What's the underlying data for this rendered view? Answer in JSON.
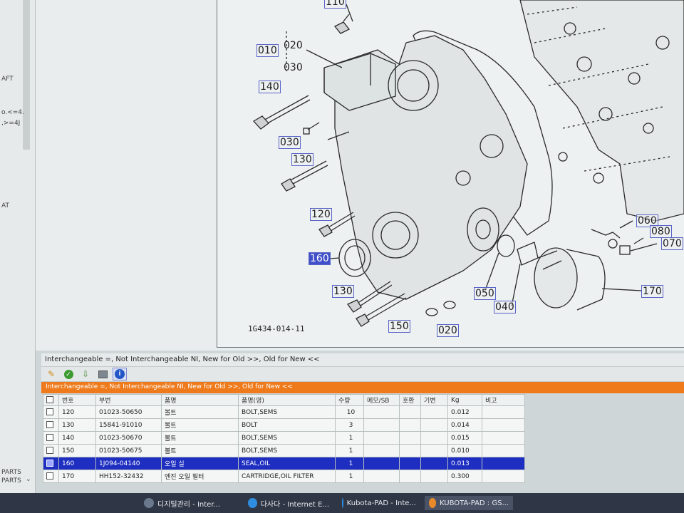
{
  "sidebar": {
    "fragments": [
      "AFT",
      "o.<=4.",
      ",>=4J",
      "AT"
    ],
    "bottom_1": "PARTS",
    "bottom_2": "PARTS"
  },
  "drawing": {
    "figure_id": "1G434-014-11",
    "callouts": {
      "c110": "110",
      "c010": "010",
      "c020a": "020",
      "c030a": "030",
      "c140": "140",
      "c030b": "030",
      "c130a": "130",
      "c120": "120",
      "c160": "160",
      "c130b": "130",
      "c150": "150",
      "c020b": "020",
      "c050": "050",
      "c040": "040",
      "c060": "060",
      "c080": "080",
      "c070": "070",
      "c170": "170"
    }
  },
  "legend": "Interchangeable =, Not Interchangeable NI, New for Old >>, Old for New <<",
  "toolbar": {
    "icons": [
      "export-icon",
      "confirm-icon",
      "import-icon",
      "print-icon",
      "info-icon"
    ]
  },
  "banner": "Interchangeable =, Not Interchangeable NI, New for Old >>, Old for New <<",
  "table": {
    "headers": [
      "번호",
      "부번",
      "품명",
      "품명(영)",
      "수량",
      "메모/SB",
      "호환",
      "기변",
      "Kg",
      "비고"
    ],
    "rows": [
      {
        "no": "120",
        "part": "01023-50650",
        "name_kr": "볼트",
        "name_en": "BOLT,SEMS",
        "qty": "10",
        "memo": "",
        "compat": "",
        "change": "",
        "kg": "0.012",
        "note": ""
      },
      {
        "no": "130",
        "part": "15841-91010",
        "name_kr": "볼트",
        "name_en": "BOLT",
        "qty": "3",
        "memo": "",
        "compat": "",
        "change": "",
        "kg": "0.014",
        "note": ""
      },
      {
        "no": "140",
        "part": "01023-50670",
        "name_kr": "볼트",
        "name_en": "BOLT,SEMS",
        "qty": "1",
        "memo": "",
        "compat": "",
        "change": "",
        "kg": "0.015",
        "note": ""
      },
      {
        "no": "150",
        "part": "01023-50675",
        "name_kr": "볼트",
        "name_en": "BOLT,SEMS",
        "qty": "1",
        "memo": "",
        "compat": "",
        "change": "",
        "kg": "0.010",
        "note": ""
      },
      {
        "no": "160",
        "part": "1J094-04140",
        "name_kr": "오일 실",
        "name_en": "SEAL,OIL",
        "qty": "1",
        "memo": "",
        "compat": "",
        "change": "",
        "kg": "0.013",
        "note": ""
      },
      {
        "no": "170",
        "part": "HH152-32432",
        "name_kr": "엔진 오일 필터",
        "name_en": "CARTRIDGE,OIL FILTER",
        "qty": "1",
        "memo": "",
        "compat": "",
        "change": "",
        "kg": "0.300",
        "note": ""
      }
    ]
  },
  "taskbar": {
    "items": [
      {
        "label": "디지털관리 - Inter..."
      },
      {
        "label": "다사다 - Internet E..."
      },
      {
        "label": "Kubota-PAD - Inte..."
      },
      {
        "label": "KUBOTA-PAD : GS..."
      }
    ]
  },
  "colors": {
    "banner": "#ee7a1b",
    "selection": "#1d2ec0",
    "callout_border": "#5a63c8"
  }
}
